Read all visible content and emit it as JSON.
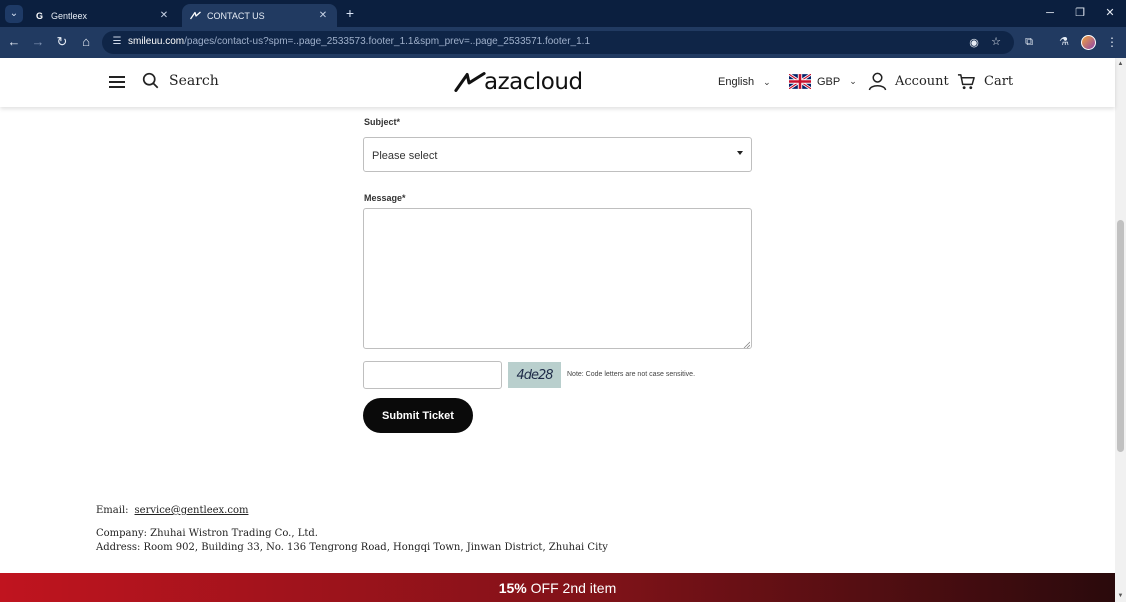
{
  "browser": {
    "tabs": [
      {
        "title": "Gentleex",
        "favicon": "G",
        "active": false
      },
      {
        "title": "CONTACT US",
        "favicon": "~",
        "active": true
      }
    ],
    "url_host": "smileuu.com",
    "url_path": "/pages/contact-us?spm=..page_2533573.footer_1.1&spm_prev=..page_2533571.footer_1.1"
  },
  "header": {
    "search_label": "Search",
    "logo_text": "azacloud",
    "language": "English",
    "currency": "GBP",
    "account_label": "Account",
    "cart_label": "Cart"
  },
  "form": {
    "subject_label": "Subject*",
    "subject_placeholder": "Please select",
    "message_label": "Message*",
    "captcha_code": "4de28",
    "captcha_note": "Note: Code letters are not case sensitive.",
    "submit_label": "Submit Ticket"
  },
  "footer": {
    "email_label": "Email:",
    "email_value": "service@gentleex.com",
    "company": "Company: Zhuhai Wistron Trading Co., Ltd.",
    "address": "Address: Room 902, Building 33, No. 136 Tengrong Road, Hongqi Town, Jinwan District, Zhuhai City"
  },
  "promo": {
    "highlight": "15%",
    "text": "OFF 2nd item"
  },
  "colors": {
    "chrome_dark": "#0b1f3f",
    "chrome_bar": "#213a61",
    "promo_red": "#c0141f",
    "button_black": "#0a0a0a",
    "captcha_bg": "#b9cfcd"
  }
}
